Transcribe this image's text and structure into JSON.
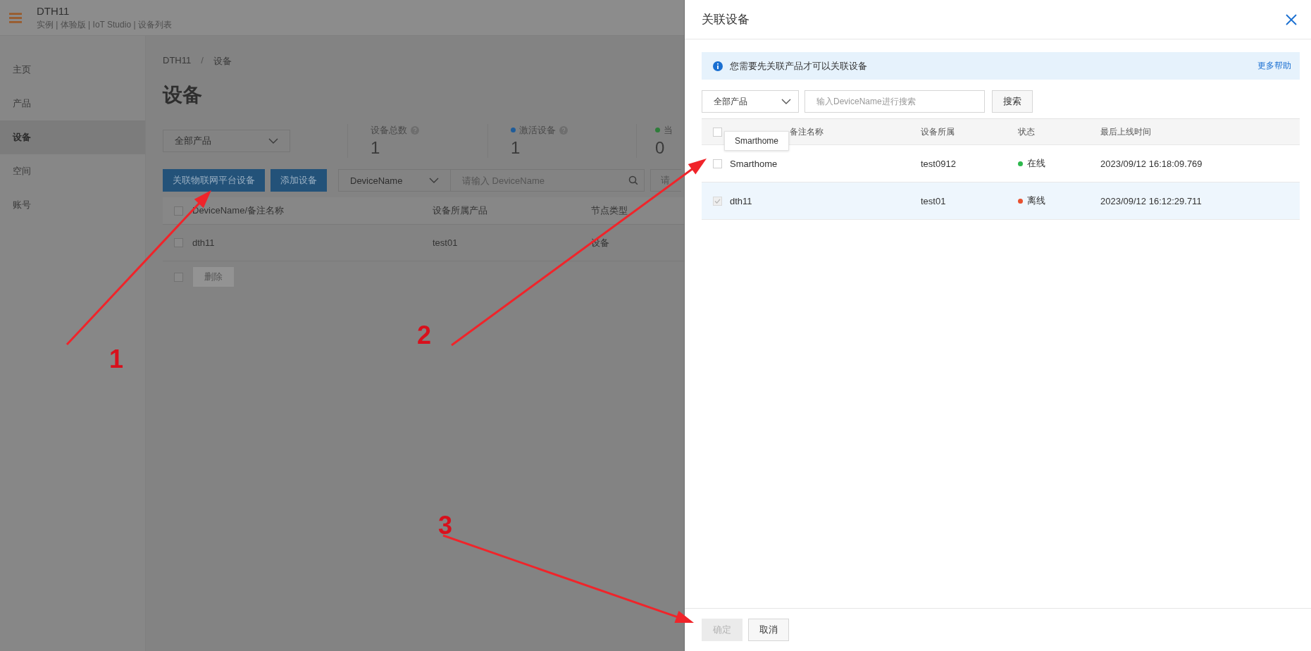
{
  "header": {
    "title": "DTH11",
    "path": "实例 | 体验版 | IoT Studio | 设备列表"
  },
  "sidebar": {
    "items": [
      {
        "label": "主页",
        "selected": false
      },
      {
        "label": "产品",
        "selected": false
      },
      {
        "label": "设备",
        "selected": true
      },
      {
        "label": "空间",
        "selected": false
      },
      {
        "label": "账号",
        "selected": false
      }
    ]
  },
  "page": {
    "breadcrumb": [
      "DTH11",
      "/",
      "设备"
    ],
    "title": "设备",
    "product_filter": "全部产品",
    "stats": [
      {
        "label": "设备总数",
        "value": "1",
        "help": true
      },
      {
        "label": "激活设备",
        "value": "1",
        "help": true,
        "color": "#1f5c99"
      },
      {
        "label": "当",
        "value": "0",
        "help": false,
        "color": "#2e7d3a"
      }
    ],
    "buttons": [
      "关联物联网平台设备",
      "添加设备"
    ],
    "search": {
      "field": "DeviceName",
      "placeholder": "请输入 DeviceName"
    },
    "filter_placeholder": "请",
    "table": {
      "all_checked": false,
      "columns": [
        "DeviceName/备注名称",
        "设备所属产品",
        "节点类型"
      ],
      "rows": [
        {
          "cells": [
            "dth11",
            "test01",
            "设备"
          ],
          "checked": false
        }
      ]
    },
    "footer_checked": false,
    "delete_button": "删除"
  },
  "drawer": {
    "title": "关联设备",
    "info": "您需要先关联产品才可以关联设备",
    "help_link": "更多帮助",
    "product_filter": "全部产品",
    "search_placeholder": "输入DeviceName进行搜索",
    "search_button": "搜索",
    "all_checked": false,
    "columns": [
      "备注名称",
      "设备所属",
      "状态",
      "最后上线时间"
    ],
    "tooltip": "Smarthome",
    "rows": [
      {
        "name": "Smarthome",
        "product": "test0912",
        "status": "在线",
        "color": "#2db84d",
        "time": "2023/09/12 16:18:09.769",
        "checked": false,
        "disabled": false
      },
      {
        "name": "dth11",
        "product": "test01",
        "status": "离线",
        "color": "#e8512f",
        "time": "2023/09/12 16:12:29.711",
        "checked": true,
        "disabled": true
      }
    ],
    "buttons": [
      {
        "label": "确定",
        "disabled": true
      },
      {
        "label": "取消",
        "disabled": false
      }
    ]
  },
  "annotations": [
    {
      "label": "1"
    },
    {
      "label": "2"
    },
    {
      "label": "3"
    }
  ]
}
